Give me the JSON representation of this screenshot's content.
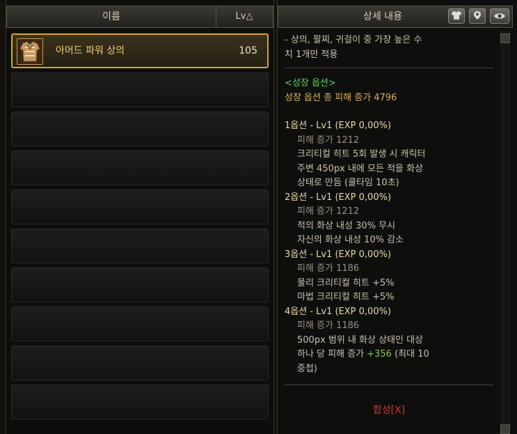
{
  "list": {
    "header_name": "이름",
    "header_lv": "Lv△",
    "selected_item": {
      "name": "아머드 파워 상의",
      "level": "105",
      "icon": "armor-top-icon"
    },
    "empty_rows": 9
  },
  "detail": {
    "title": "상세 내용",
    "buttons": [
      "armor-view-icon",
      "location-pin-icon",
      "eye-icon"
    ],
    "desc1": "- 상의, 팔찌, 귀걸이 중 가장 높은 수",
    "desc2": "치 1개만 적용",
    "growth_header": "<성장 옵션>",
    "growth_total": "성장 옵션 총 피해 증가 4796",
    "opt1": {
      "title": "1옵션 - Lv1 (EXP 0,00%)",
      "damage": "피해 증가 1212",
      "lines": [
        "크리티컬 히트 5회 발생 시 캐릭터",
        "주변 450px 내에 모든 적을 화상",
        "상태로 만듬 (쿨타임 10초)"
      ]
    },
    "opt2": {
      "title": "2옵션 - Lv1 (EXP 0,00%)",
      "damage": "피해 증가 1212",
      "lines": [
        "적의 화상 내성 30% 무시",
        "자신의 화상 내성 10% 감소"
      ]
    },
    "opt3": {
      "title": "3옵션 - Lv1 (EXP 0,00%)",
      "damage": "피해 증가 1186",
      "lines": [
        "물리 크리티컬 히트 +5%",
        "마법 크리티컬 히트 +5%"
      ]
    },
    "opt4": {
      "title": "4옵션 - Lv1 (EXP 0,00%)",
      "damage": "피해 증가 1186",
      "line1": "500px 범위 내 화상 상태인 대상",
      "line2_a": "하나 당 피해 증가 ",
      "line2_b": "+356",
      "line2_c": " (최대 10",
      "line3": "중첩)"
    },
    "synthesis": "합성[X]"
  },
  "colors": {
    "selected_border": "#d8a62c",
    "item_name": "#f1d07c",
    "growth_green": "#5fd35f",
    "synthesis_red": "#e0302a"
  }
}
